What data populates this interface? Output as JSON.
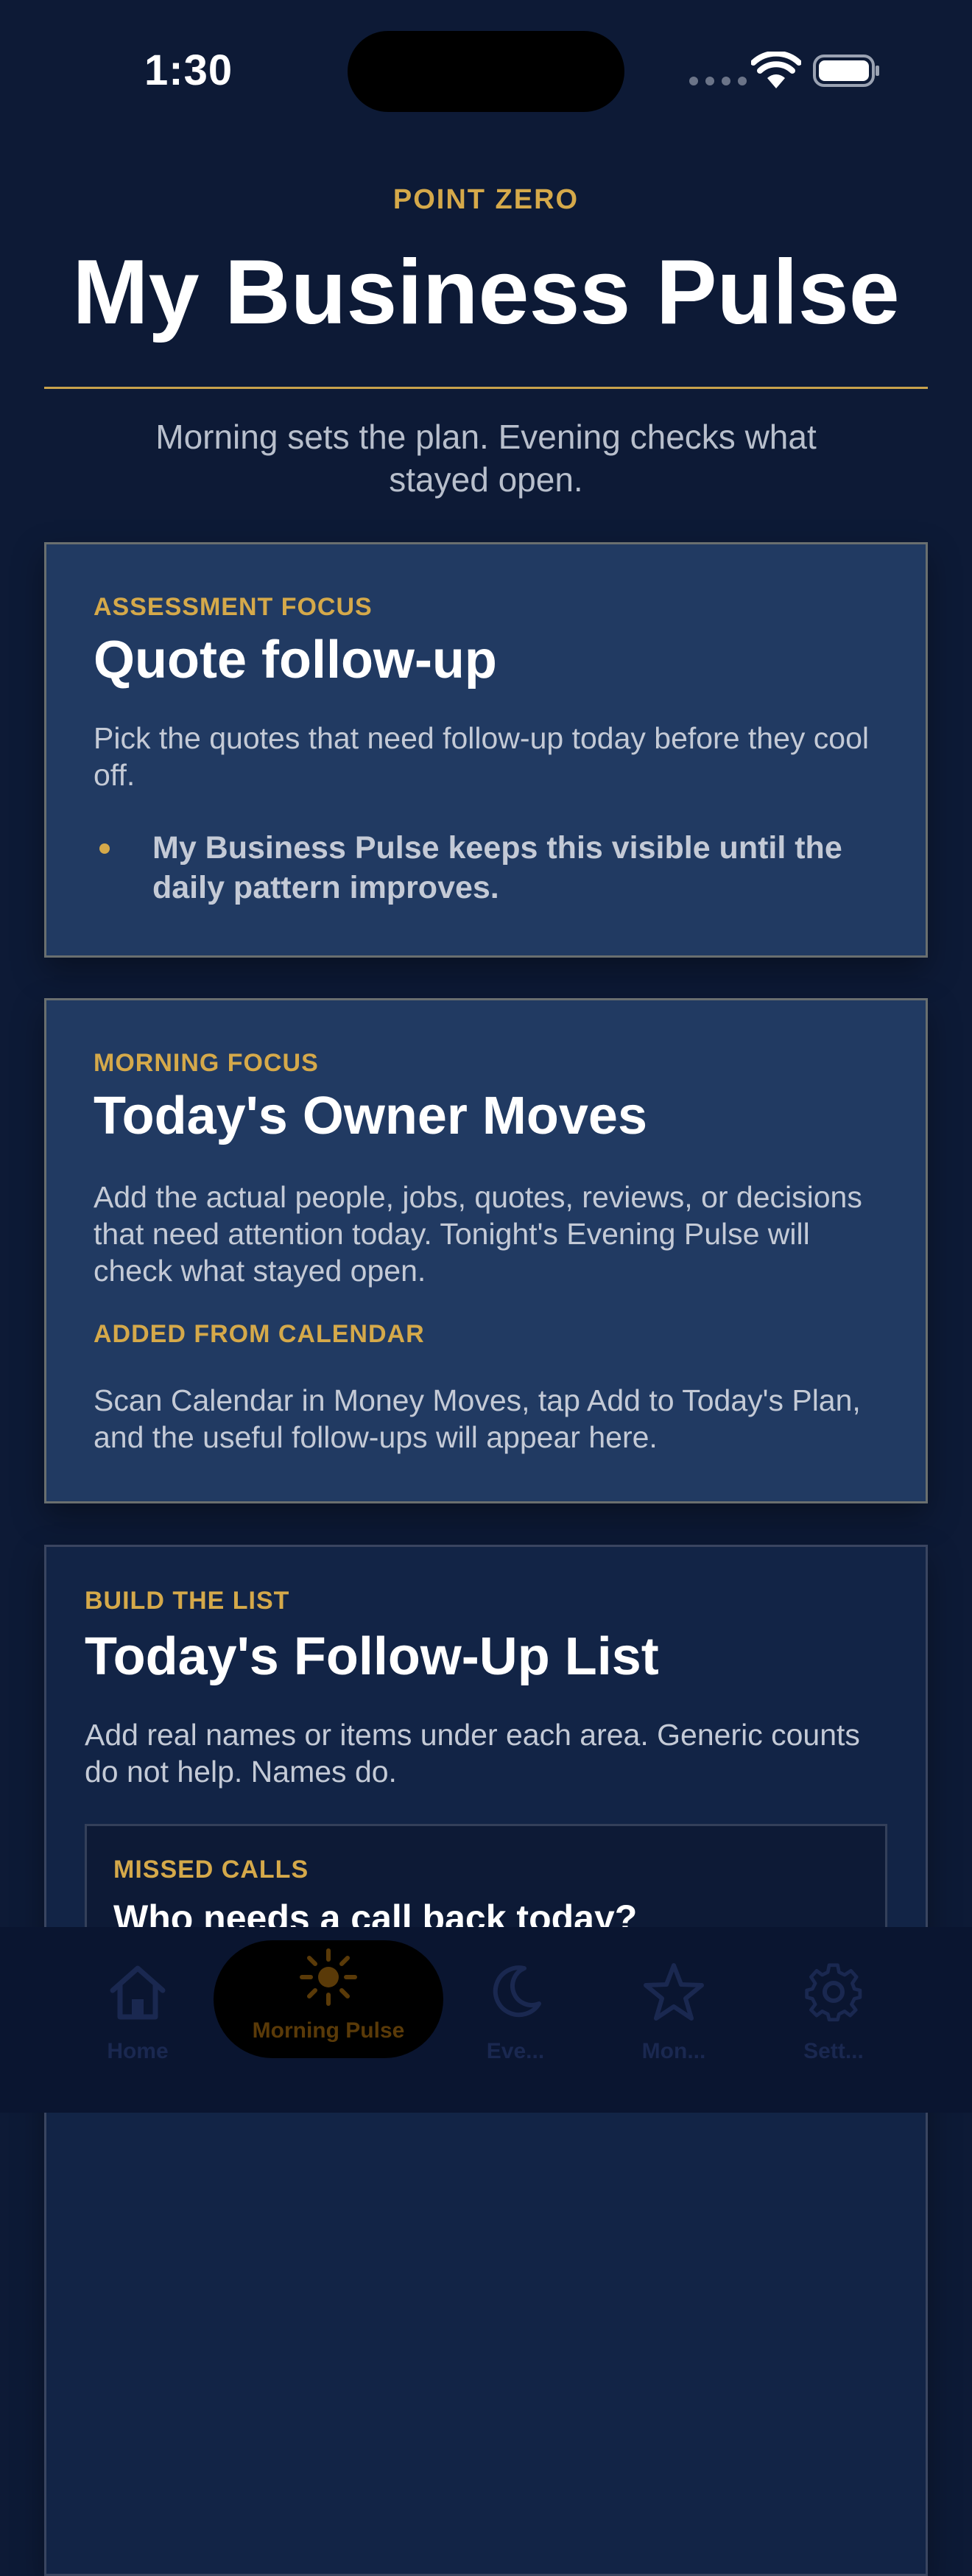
{
  "status_bar": {
    "time": "1:30"
  },
  "header": {
    "eyebrow": "POINT ZERO",
    "title": "My Business Pulse",
    "subtitle": "Morning sets the plan. Evening checks what stayed open."
  },
  "assessment_card": {
    "eyebrow": "ASSESSMENT FOCUS",
    "title": "Quote follow-up",
    "body": "Pick the quotes that need follow-up today before they cool off.",
    "bullet": "My Business Pulse keeps this visible until the daily pattern improves."
  },
  "morning_card": {
    "eyebrow": "MORNING FOCUS",
    "title": "Today's Owner Moves",
    "body": "Add the actual people, jobs, quotes, reviews, or decisions that need attention today. Tonight's Evening Pulse will check what stayed open.",
    "calendar_eyebrow": "ADDED FROM CALENDAR",
    "calendar_body": "Scan Calendar in Money Moves, tap Add to Today's Plan, and the useful follow-ups will appear here."
  },
  "followup_card": {
    "eyebrow": "BUILD THE LIST",
    "title": "Today's Follow-Up List",
    "body": "Add real names or items under each area. Generic counts do not help. Names do.",
    "missed_calls": {
      "eyebrow": "MISSED CALLS",
      "title": "Who needs a call back today?"
    }
  },
  "tabbar": {
    "tabs": [
      {
        "label": "Home",
        "icon": "home-icon"
      },
      {
        "label": "Morning Pulse",
        "icon": "sun-icon",
        "active": true
      },
      {
        "label": "Eve...",
        "icon": "moon-icon"
      },
      {
        "label": "Mon...",
        "icon": "star-icon"
      },
      {
        "label": "Sett...",
        "icon": "gear-icon"
      }
    ]
  },
  "colors": {
    "background": "#0d1a36",
    "accent_gold": "#d5a94a",
    "card_blue": "#213a62",
    "text_muted": "#c4cad6"
  }
}
